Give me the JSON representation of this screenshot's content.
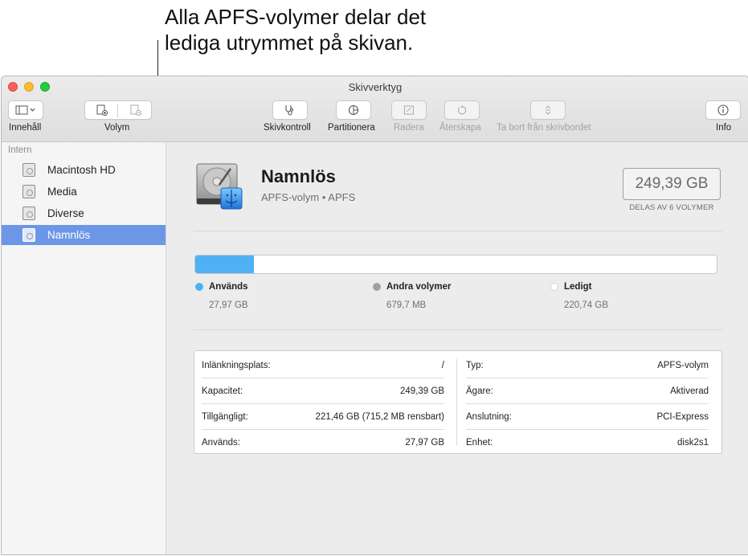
{
  "annotation": {
    "text": "Alla APFS-volymer delar det\nlediga utrymmet på skivan."
  },
  "window": {
    "title": "Skivverktyg"
  },
  "toolbar": {
    "view_label": "Innehåll",
    "volume_label": "Volym",
    "first_aid": "Skivkontroll",
    "partition": "Partitionera",
    "erase": "Radera",
    "restore": "Återskapa",
    "unmount": "Ta bort från skrivbordet",
    "info": "Info"
  },
  "sidebar": {
    "section": "Intern",
    "items": [
      {
        "label": "Macintosh HD",
        "selected": false
      },
      {
        "label": "Media",
        "selected": false
      },
      {
        "label": "Diverse",
        "selected": false
      },
      {
        "label": "Namnlös",
        "selected": true
      }
    ]
  },
  "volume": {
    "name": "Namnlös",
    "subtitle": "APFS-volym • APFS",
    "size": "249,39 GB",
    "shared_note": "DELAS AV 6 VOLYMER"
  },
  "usage": {
    "used_fraction": 0.112,
    "legend": [
      {
        "name": "Används",
        "value": "27,97 GB",
        "color": "#4fb1f4"
      },
      {
        "name": "Andra volymer",
        "value": "679,7 MB",
        "color": "#a0a0a0"
      },
      {
        "name": "Ledigt",
        "value": "220,74 GB",
        "color": "#ffffff"
      }
    ]
  },
  "info": {
    "left": [
      {
        "key": "Inlänkningsplats:",
        "value": "/"
      },
      {
        "key": "Kapacitet:",
        "value": "249,39 GB"
      },
      {
        "key": "Tillgängligt:",
        "value": "221,46 GB (715,2 MB rensbart)"
      },
      {
        "key": "Används:",
        "value": "27,97 GB"
      }
    ],
    "right": [
      {
        "key": "Typ:",
        "value": "APFS-volym"
      },
      {
        "key": "Ägare:",
        "value": "Aktiverad"
      },
      {
        "key": "Anslutning:",
        "value": "PCI-Express"
      },
      {
        "key": "Enhet:",
        "value": "disk2s1"
      }
    ]
  }
}
